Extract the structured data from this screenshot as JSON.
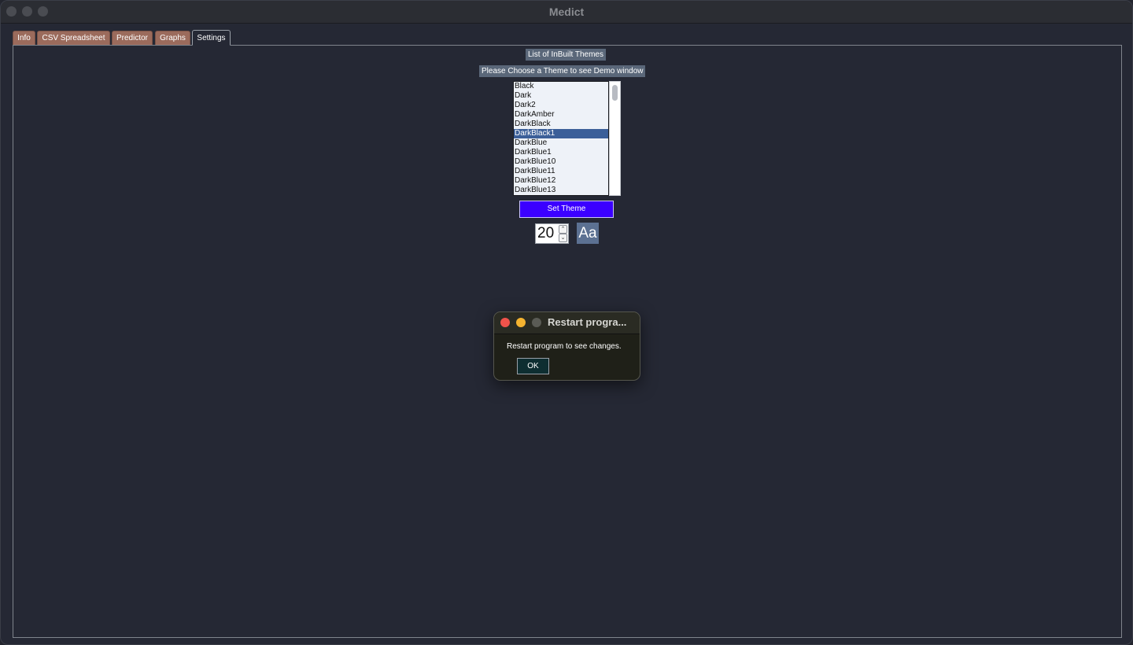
{
  "window": {
    "title": "Medict"
  },
  "tabs": [
    {
      "label": "Info",
      "active": false
    },
    {
      "label": "CSV Spreadsheet",
      "active": false
    },
    {
      "label": "Predictor",
      "active": false
    },
    {
      "label": "Graphs",
      "active": false
    },
    {
      "label": "Settings",
      "active": true
    }
  ],
  "settings": {
    "themes_heading": "List of InBuilt Themes",
    "choose_prompt": "Please Choose a Theme  to see Demo window",
    "theme_list": [
      "Black",
      "Dark",
      "Dark2",
      "DarkAmber",
      "DarkBlack",
      "DarkBlack1",
      "DarkBlue",
      "DarkBlue1",
      "DarkBlue10",
      "DarkBlue11",
      "DarkBlue12",
      "DarkBlue13"
    ],
    "selected_theme": "DarkBlack1",
    "set_theme_label": "Set Theme",
    "font_size": "20",
    "spin_up_glyph": "⌃",
    "spin_down_glyph": "⌄",
    "font_button_label": "Aa"
  },
  "dialog": {
    "title": "Restart progra...",
    "message": "Restart program to see changes.",
    "ok_label": "OK"
  },
  "colors": {
    "background": "#252834",
    "tab_inactive": "#9b6b5c",
    "set_theme_button": "#3b00ff",
    "list_selected": "#3b5f99",
    "label_box": "#5a6779"
  }
}
